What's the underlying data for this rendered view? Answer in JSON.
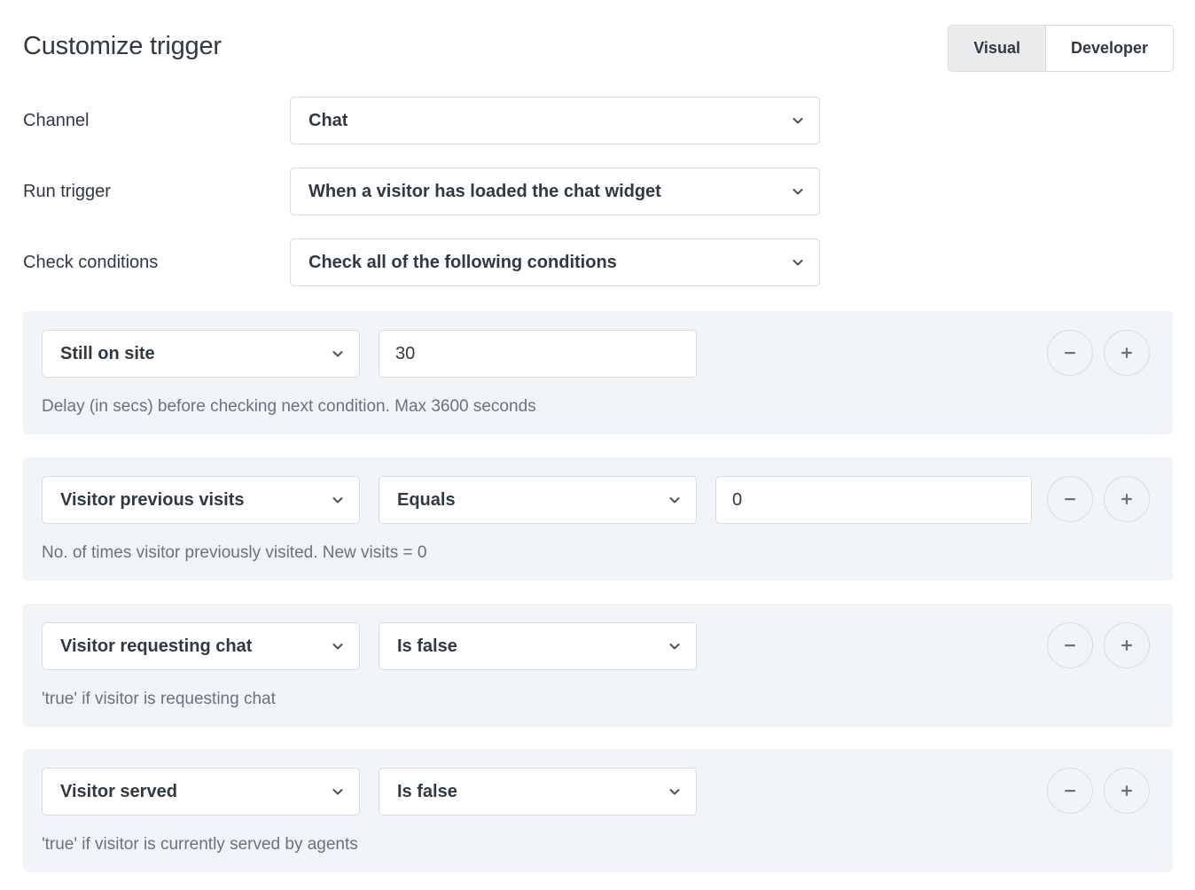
{
  "header": {
    "title": "Customize trigger",
    "toggle": {
      "options": [
        {
          "label": "Visual",
          "active": true
        },
        {
          "label": "Developer",
          "active": false
        }
      ]
    }
  },
  "form": {
    "rows": [
      {
        "label": "Channel",
        "value": "Chat"
      },
      {
        "label": "Run trigger",
        "value": "When a visitor has loaded the chat widget"
      },
      {
        "label": "Check conditions",
        "value": "Check all of the following conditions"
      }
    ]
  },
  "conditions": [
    {
      "attribute": "Still on site",
      "operator": null,
      "value": "30",
      "help": "Delay (in secs) before checking next condition. Max 3600 seconds",
      "remove_label": "−",
      "add_label": "+"
    },
    {
      "attribute": "Visitor previous visits",
      "operator": "Equals",
      "value": "0",
      "help": "No. of times visitor previously visited. New visits = 0",
      "remove_label": "−",
      "add_label": "+"
    },
    {
      "attribute": "Visitor requesting chat",
      "operator": "Is false",
      "value": null,
      "help": "'true' if visitor is requesting chat",
      "remove_label": "−",
      "add_label": "+"
    },
    {
      "attribute": "Visitor served",
      "operator": "Is false",
      "value": null,
      "help": "'true' if visitor is currently served by agents",
      "remove_label": "−",
      "add_label": "+"
    }
  ],
  "icons": {
    "chevron": "chevron-down-icon",
    "minus": "minus-icon",
    "plus": "plus-icon"
  },
  "colors": {
    "text": "#2f3941",
    "muted": "#68737d",
    "border": "#d8dcde",
    "panel": "#f1f5f9",
    "toggle_active": "#e9ebed"
  }
}
